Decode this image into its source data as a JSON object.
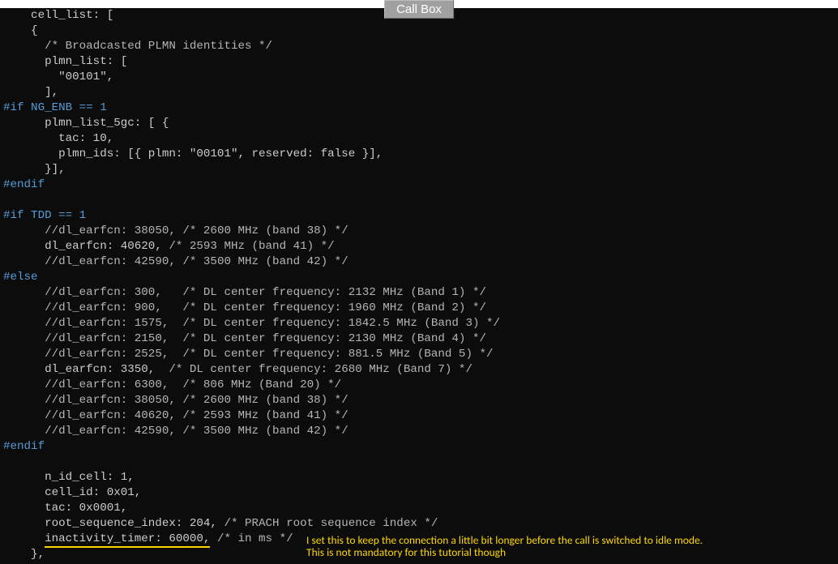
{
  "button": {
    "label": "Call Box"
  },
  "code": {
    "l1": "    cell_list: [",
    "l2": "    {",
    "l3a": "      ",
    "l3b": "/* Broadcasted PLMN identities */",
    "l4": "      plmn_list: [",
    "l5": "        \"00101\",",
    "l6": "      ],",
    "l7": "#if NG_ENB == 1",
    "l8": "      plmn_list_5gc: [ {",
    "l9": "        tac: 10,",
    "l10": "        plmn_ids: [{ plmn: \"00101\", reserved: false }],",
    "l11": "      }],",
    "l12": "#endif",
    "l13": "",
    "l14": "#if TDD == 1",
    "l15a": "      ",
    "l15b": "//dl_earfcn: 38050, /* 2600 MHz (band 38) */",
    "l16": "      dl_earfcn: 40620, ",
    "l16b": "/* 2593 MHz (band 41) */",
    "l17a": "      ",
    "l17b": "//dl_earfcn: 42590, /* 3500 MHz (band 42) */",
    "l18": "#else",
    "l19a": "      ",
    "l19b": "//dl_earfcn: 300,   /* DL center frequency: 2132 MHz (Band 1) */",
    "l20a": "      ",
    "l20b": "//dl_earfcn: 900,   /* DL center frequency: 1960 MHz (Band 2) */",
    "l21a": "      ",
    "l21b": "//dl_earfcn: 1575,  /* DL center frequency: 1842.5 MHz (Band 3) */",
    "l22a": "      ",
    "l22b": "//dl_earfcn: 2150,  /* DL center frequency: 2130 MHz (Band 4) */",
    "l23a": "      ",
    "l23b": "//dl_earfcn: 2525,  /* DL center frequency: 881.5 MHz (Band 5) */",
    "l24": "      dl_earfcn: 3350,  ",
    "l24b": "/* DL center frequency: 2680 MHz (Band 7) */",
    "l25a": "      ",
    "l25b": "//dl_earfcn: 6300,  /* 806 MHz (Band 20) */",
    "l26a": "      ",
    "l26b": "//dl_earfcn: 38050, /* 2600 MHz (band 38) */",
    "l27a": "      ",
    "l27b": "//dl_earfcn: 40620, /* 2593 MHz (band 41) */",
    "l28a": "      ",
    "l28b": "//dl_earfcn: 42590, /* 3500 MHz (band 42) */",
    "l29": "#endif",
    "l30": "",
    "l31": "      n_id_cell: 1,",
    "l32": "      cell_id: 0x01,",
    "l33": "      tac: 0x0001,",
    "l34": "      root_sequence_index: 204, ",
    "l34b": "/* PRACH root sequence index */",
    "l35a": "      ",
    "l35hl": "inactivity_timer: 60000,",
    "l35b": " ",
    "l35c": "/* in ms */",
    "l36": "    },"
  },
  "annotation": {
    "line1": "I set this to keep the connection a little bit longer before the call is switched to idle mode.",
    "line2": "This is not mandatory for this tutorial though"
  }
}
